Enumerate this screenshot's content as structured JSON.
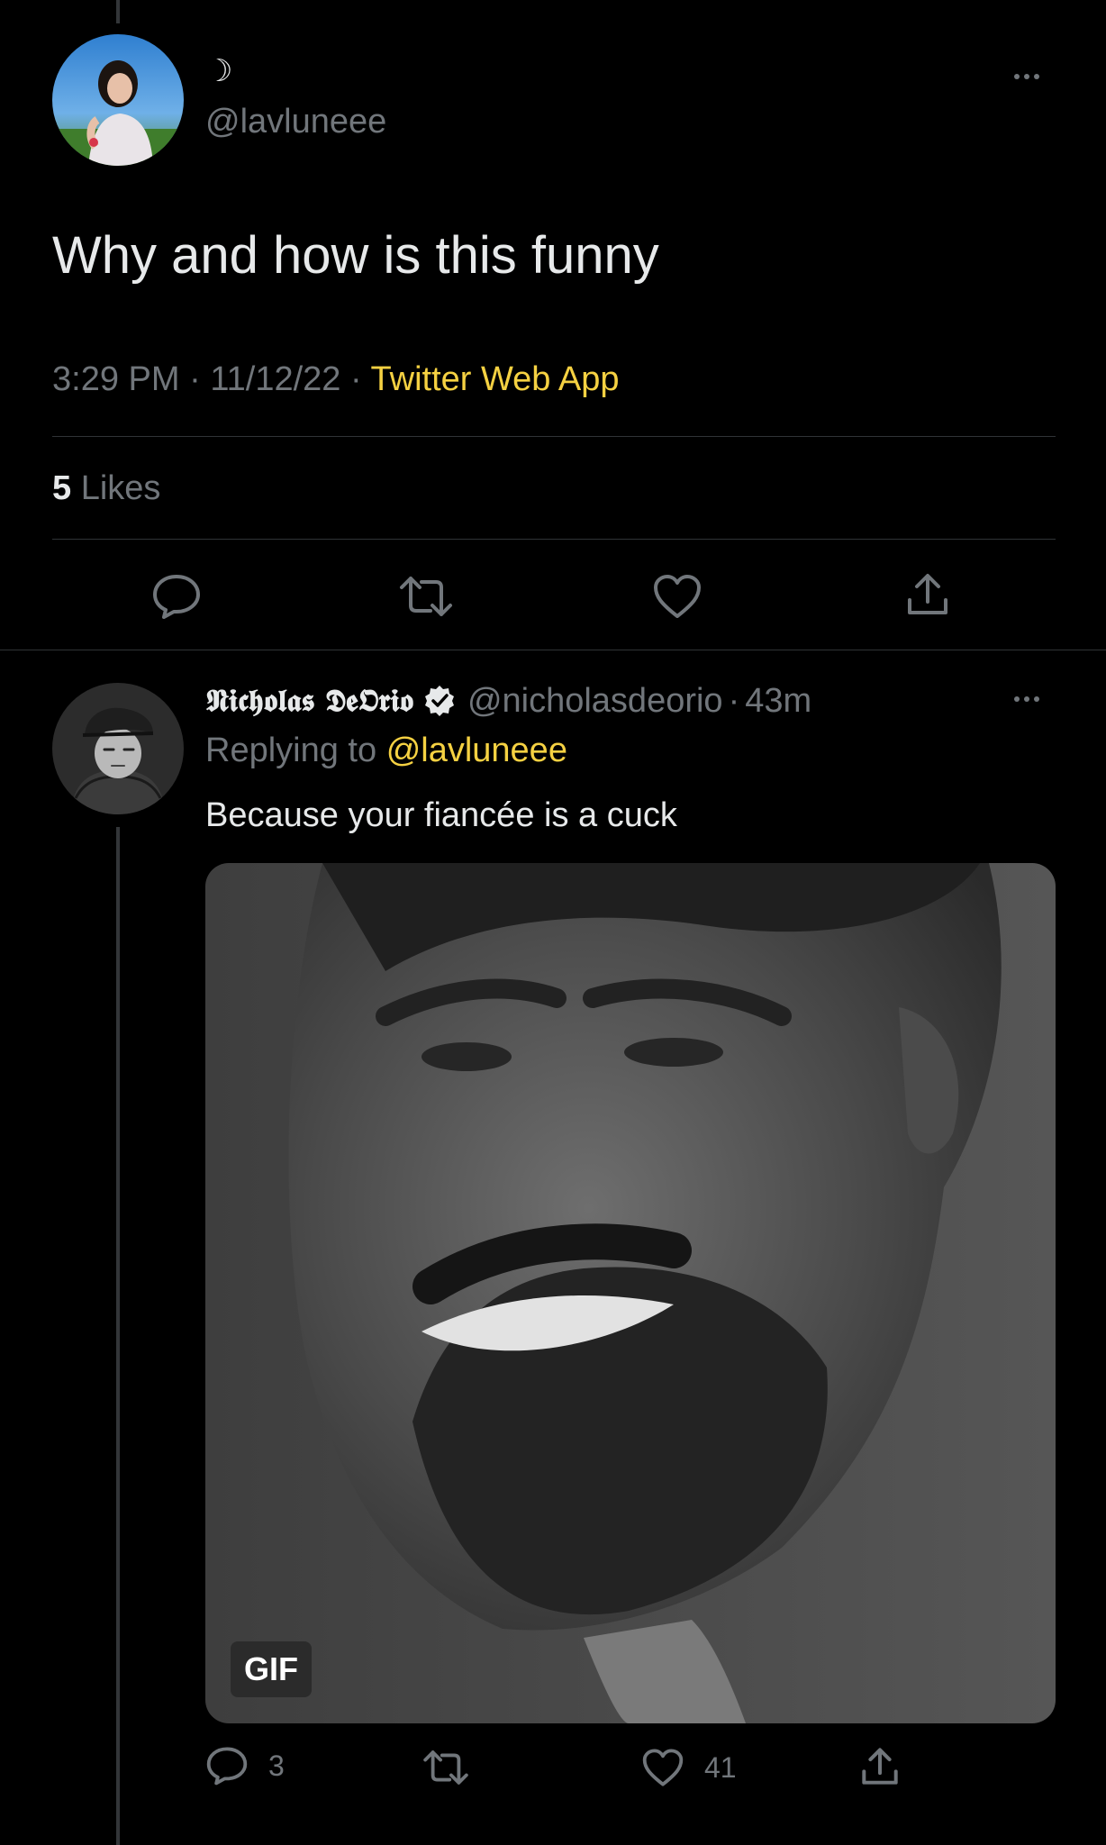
{
  "main_tweet": {
    "display_name": "☽",
    "handle": "@lavluneee",
    "text": "Why and how is this funny",
    "time": "3:29 PM",
    "sep1": "·",
    "date": "11/12/22",
    "sep2": "·",
    "source": "Twitter Web App",
    "likes_count": "5",
    "likes_label": "Likes"
  },
  "reply": {
    "display_name": "𝕹𝖎𝖈𝖍𝖔𝖑𝖆𝖘 𝕯𝖊𝕺𝖗𝖎𝖔",
    "handle": "@nicholasdeorio",
    "sep": "·",
    "time_ago": "43m",
    "replying_prefix": "Replying to",
    "replying_handle": "@lavluneee",
    "text": "Because your fiancée is a cuck",
    "media_badge": "GIF",
    "reply_count": "3",
    "like_count": "41"
  },
  "colors": {
    "background": "#000000",
    "accent": "#f5d142",
    "muted": "#71767b",
    "divider": "#2f3336"
  },
  "icons": {
    "more": "more-horizontal-icon",
    "reply": "reply-icon",
    "retweet": "retweet-icon",
    "like": "heart-icon",
    "share": "share-icon",
    "verified": "verified-badge-icon"
  }
}
